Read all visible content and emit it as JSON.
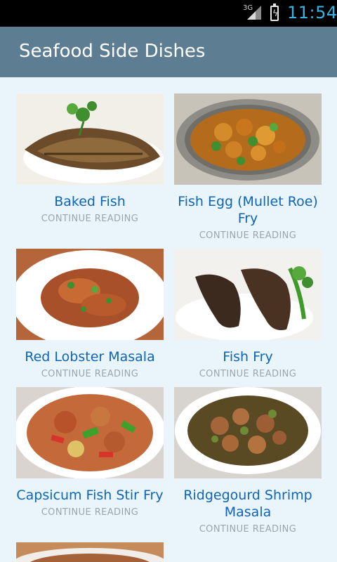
{
  "status_bar": {
    "network": "3G",
    "time": "11:54",
    "icons": [
      "signal-icon",
      "battery-charging-icon"
    ]
  },
  "action_bar": {
    "title": "Seafood Side Dishes"
  },
  "recipes": [
    {
      "title": "Baked Fish",
      "action": "CONTINUE READING",
      "image": "baked-fish-image"
    },
    {
      "title": "Fish Egg (Mullet Roe) Fry",
      "action": "CONTINUE READING",
      "image": "fish-egg-fry-image"
    },
    {
      "title": "Red Lobster Masala",
      "action": "CONTINUE READING",
      "image": "red-lobster-masala-image"
    },
    {
      "title": "Fish Fry",
      "action": "CONTINUE READING",
      "image": "fish-fry-image"
    },
    {
      "title": "Capsicum Fish Stir Fry",
      "action": "CONTINUE READING",
      "image": "capsicum-fish-stir-fry-image"
    },
    {
      "title": "Ridgegourd Shrimp Masala",
      "action": "CONTINUE READING",
      "image": "ridgegourd-shrimp-masala-image"
    }
  ],
  "colors": {
    "status_bar": "#000000",
    "clock": "#35b5e5",
    "action_bar": "#5d7e92",
    "background": "#e9f5fb",
    "title_link": "#0e64b8",
    "continue_text": "#9aa6ab"
  }
}
